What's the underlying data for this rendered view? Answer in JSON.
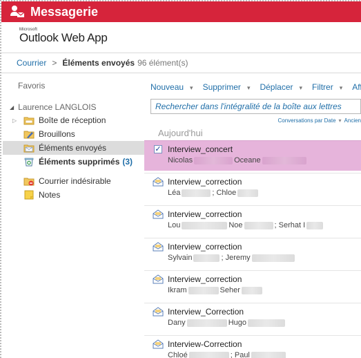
{
  "app": {
    "title": "Messagerie"
  },
  "brand": {
    "microsoft": "Microsoft",
    "product": "Outlook Web App"
  },
  "breadcrumb": {
    "root": "Courrier",
    "separator": ">",
    "current": "Éléments envoyés",
    "count": "96 élément(s)"
  },
  "nav": {
    "favoris": "Favoris",
    "account": "Laurence LANGLOIS",
    "folders": [
      {
        "label": "Boîte de réception",
        "icon": "inbox-folder-icon"
      },
      {
        "label": "Brouillons",
        "icon": "drafts-icon"
      },
      {
        "label": "Éléments envoyés",
        "icon": "sent-items-icon"
      },
      {
        "label": "Éléments supprimés",
        "count": "(3)",
        "icon": "recycle-bin-icon"
      },
      {
        "label": "Courrier indésirable",
        "icon": "junk-mail-icon"
      },
      {
        "label": "Notes",
        "icon": "notes-icon"
      }
    ]
  },
  "toolbar": {
    "new": "Nouveau",
    "delete": "Supprimer",
    "move": "Déplacer",
    "filter": "Filtrer",
    "more": "Aff"
  },
  "search": {
    "placeholder": "Rechercher dans l'intégralité de la boîte aux lettres"
  },
  "sort": {
    "conversations": "Conversations par Date",
    "order": "Ancien"
  },
  "list": {
    "group": "Aujourd'hui",
    "messages": [
      {
        "subject": "Interview_concert",
        "from": [
          "Nicolas",
          "Oceane"
        ]
      },
      {
        "subject": "Interview_correction",
        "from": [
          "Léa",
          "; Chloe"
        ]
      },
      {
        "subject": "Interview_correction",
        "from": [
          "Lou",
          "Noe",
          "; Serhat I"
        ]
      },
      {
        "subject": "Interview_correction",
        "from": [
          "Sylvain",
          "; Jeremy"
        ]
      },
      {
        "subject": "Interview_correction",
        "from": [
          "Ikram",
          "Seher"
        ]
      },
      {
        "subject": "Interview_Correction",
        "from": [
          "Dany",
          "Hugo"
        ]
      },
      {
        "subject": "Interview-Correction",
        "from": [
          "Chloé",
          "; Paul"
        ]
      }
    ]
  },
  "colors": {
    "topbar": "#d6243b",
    "selected_row": "#e6b4db",
    "link": "#1f6ea8"
  }
}
